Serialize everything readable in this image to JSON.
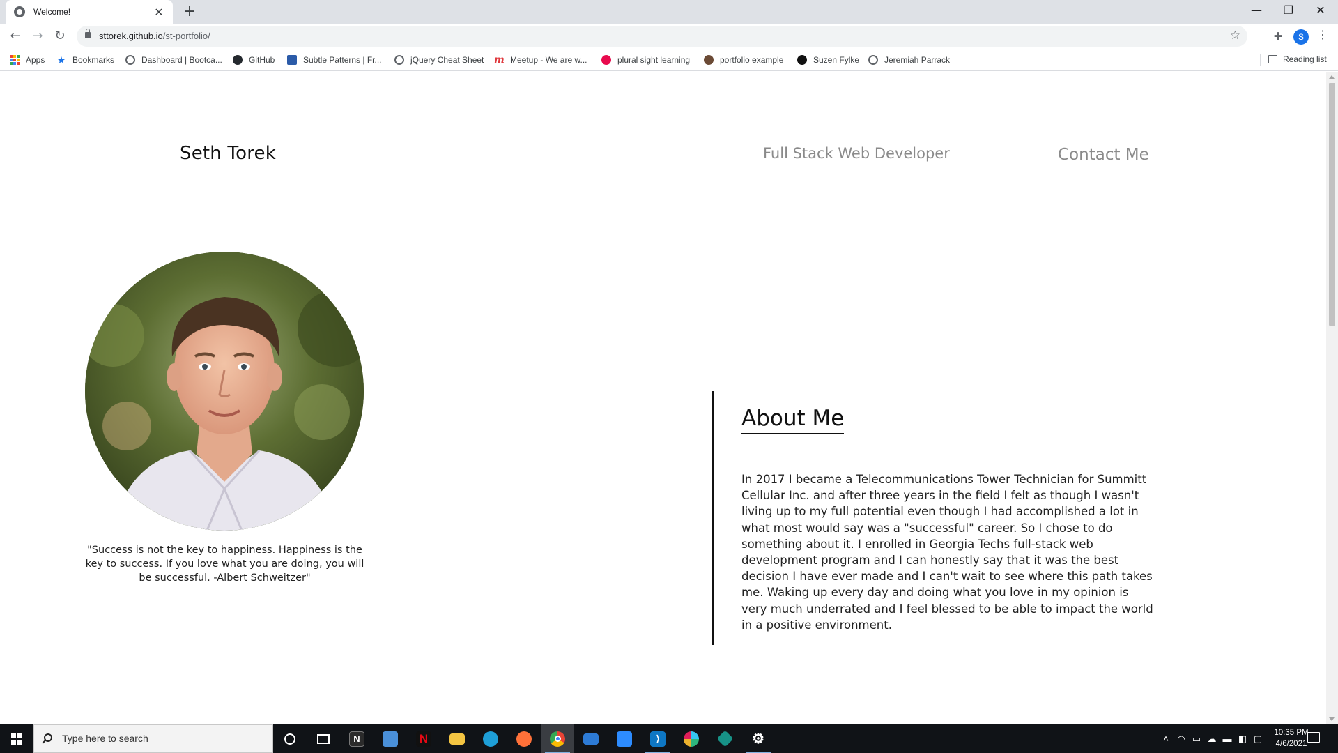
{
  "browser": {
    "tab_title": "Welcome!",
    "url_host": "sttorek.github.io",
    "url_path": "/st-portfolio/",
    "profile_initial": "S",
    "bookmarks": [
      {
        "label": "Apps",
        "icon": "apps-grid-icon"
      },
      {
        "label": "Bookmarks",
        "icon": "star-icon"
      },
      {
        "label": "Dashboard | Bootca...",
        "icon": "globe-icon"
      },
      {
        "label": "GitHub",
        "icon": "github-icon"
      },
      {
        "label": "Subtle Patterns | Fr...",
        "icon": "subtle-patterns-icon"
      },
      {
        "label": "jQuery Cheat Sheet",
        "icon": "globe-icon"
      },
      {
        "label": "Meetup - We are w...",
        "icon": "meetup-icon"
      },
      {
        "label": "plural sight learning",
        "icon": "pluralsight-icon"
      },
      {
        "label": "portfolio example",
        "icon": "avatar-icon"
      },
      {
        "label": "Suzen Fylke",
        "icon": "s-logo-icon"
      },
      {
        "label": "Jeremiah Parrack",
        "icon": "globe-icon"
      }
    ],
    "reading_list": "Reading list"
  },
  "page": {
    "site_name": "Seth Torek",
    "nav": {
      "developer": "Full Stack Web Developer",
      "contact": "Contact Me"
    },
    "quote": "\"Success is not the key to happiness. Happiness is the key to success. If you love what you are doing, you will be successful. -Albert Schweitzer\"",
    "about": {
      "title": "About Me",
      "body": "In 2017 I became a Telecommunications Tower Technician for Summitt Cellular Inc. and after three years in the field I felt as though I wasn't living up to my full potential even though I had accomplished a lot in what most would say was a \"successful\" career. So I chose to do something about it. I enrolled in Georgia Techs full-stack web development program and I can honestly say that it was the best decision I have ever made and I can't wait to see where this path takes me. Waking up every day and doing what you love in my opinion is very much underrated and I feel blessed to be able to impact the world in a positive environment."
    }
  },
  "taskbar": {
    "search_placeholder": "Type here to search",
    "time": "10:35 PM",
    "date": "4/6/2021"
  }
}
